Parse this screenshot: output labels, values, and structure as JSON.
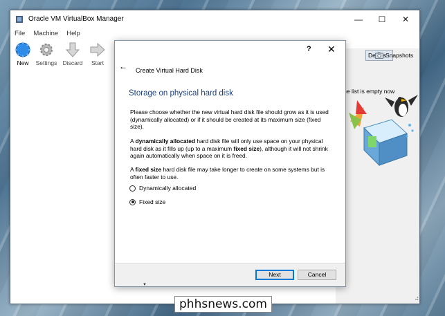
{
  "window": {
    "title": "Oracle VM VirtualBox Manager",
    "controls": {
      "minimize": "—",
      "maximize": "☐",
      "close": "✕"
    }
  },
  "menu": [
    "File",
    "Machine",
    "Help"
  ],
  "toolbar": {
    "new": "New",
    "settings": "Settings",
    "discard": "Discard",
    "start": "Start"
  },
  "right_pane": {
    "details_tab": "Details",
    "snapshots_tab": "Snapshots",
    "empty_message": "r. The list is empty now"
  },
  "dialog": {
    "help": "?",
    "close": "✕",
    "back": "←",
    "title": "Create Virtual Hard Disk",
    "heading": "Storage on physical hard disk",
    "para1": "Please choose whether the new virtual hard disk file should grow as it is used (dynamically allocated) or if it should be created at its maximum size (fixed size).",
    "para2_a": "A ",
    "para2_b": "dynamically allocated",
    "para2_c": " hard disk file will only use space on your physical hard disk as it fills up (up to a maximum ",
    "para2_d": "fixed size",
    "para2_e": "), although it will not shrink again automatically when space on it is freed.",
    "para3_a": "A ",
    "para3_b": "fixed size",
    "para3_c": " hard disk file may take longer to create on some systems but is often faster to use.",
    "options": [
      {
        "label": "Dynamically allocated",
        "selected": false
      },
      {
        "label": "Fixed size",
        "selected": true
      }
    ],
    "next_button": "Next",
    "cancel_button": "Cancel"
  },
  "watermark": "phhsnews.com",
  "colors": {
    "heading": "#1b3f7a",
    "accent": "#0078d7",
    "new_icon": "#2e8be8"
  }
}
